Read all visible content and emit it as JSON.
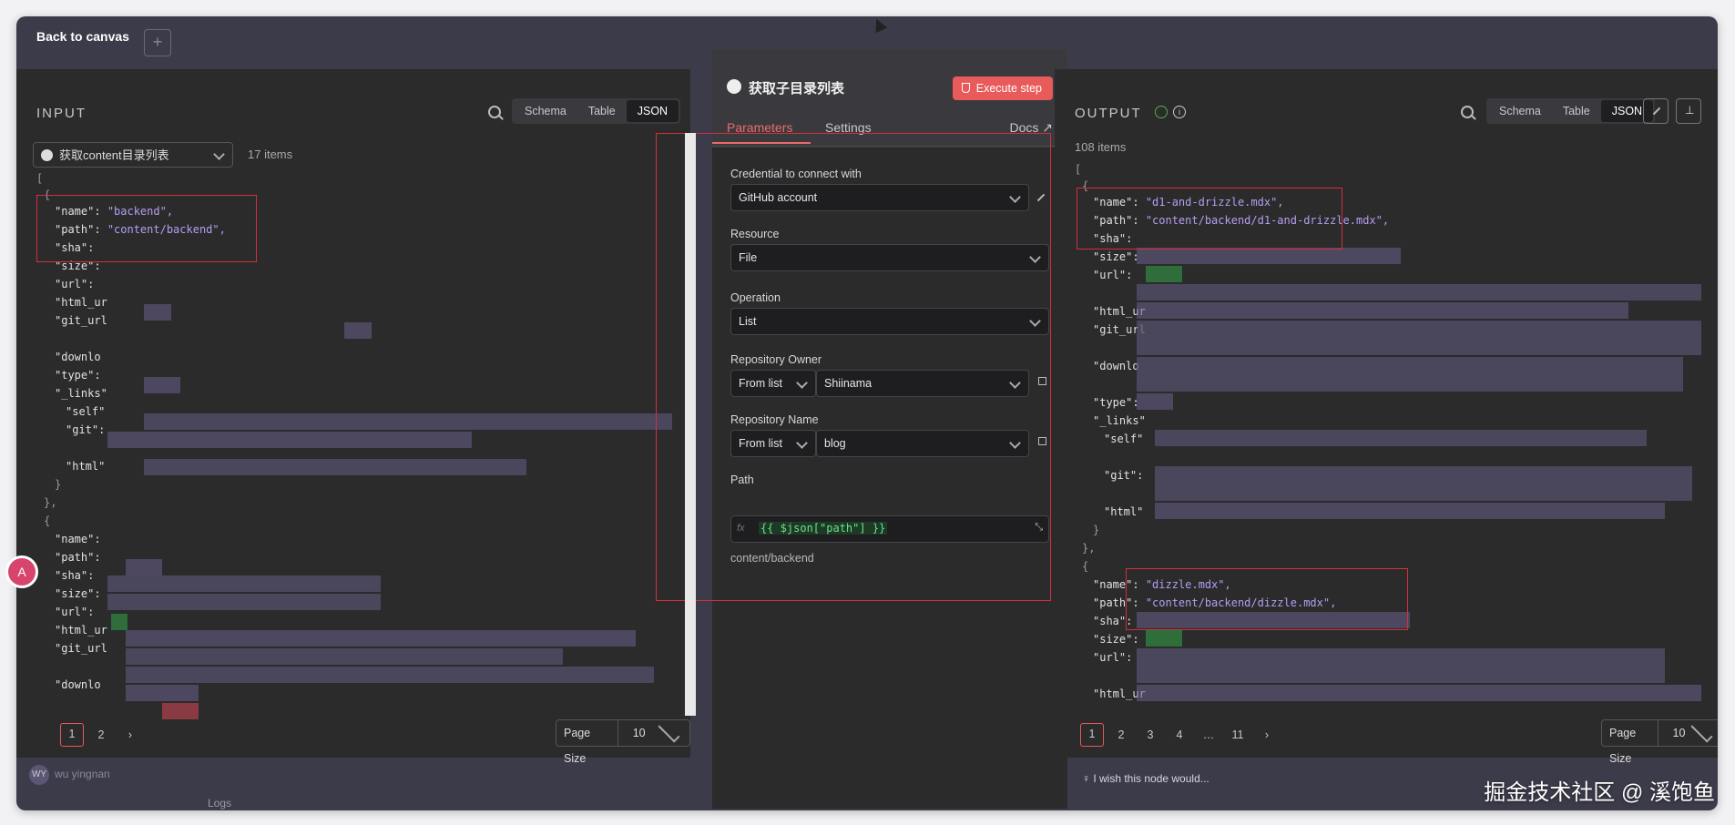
{
  "topbar": {
    "back_label": "Back to canvas",
    "plus_label": "+"
  },
  "input": {
    "title": "INPUT",
    "views": [
      "Schema",
      "Table",
      "JSON"
    ],
    "active_view": "JSON",
    "source_node": "获取content目录列表",
    "items_count": "17 items",
    "record1": {
      "name_key": "\"name\":",
      "name_val": "\"backend\",",
      "path_key": "\"path\":",
      "path_val": "\"content/backend\","
    },
    "keys": [
      "\"sha\":",
      "\"size\":",
      "\"url\":",
      "\"html_ur",
      "\"git_url",
      "\"downlo",
      "\"type\":",
      "\"_links\"",
      "\"self\"",
      "\"git\":",
      "\"html\"",
      "\"name\":",
      "\"path\":",
      "\"sha\":",
      "\"size\":",
      "\"url\":",
      "\"html_ur",
      "\"git_url",
      "\"downlo"
    ],
    "pages": [
      "1",
      "2"
    ],
    "page_size_label": "Page Size",
    "page_size": "10"
  },
  "node": {
    "title": "获取子目录列表",
    "execute_label": "Execute step",
    "tab_parameters": "Parameters",
    "tab_settings": "Settings",
    "docs_label": "Docs",
    "credential_label": "Credential to connect with",
    "credential_value": "GitHub account",
    "resource_label": "Resource",
    "resource_value": "File",
    "operation_label": "Operation",
    "operation_value": "List",
    "owner_label": "Repository Owner",
    "owner_mode": "From list",
    "owner_value": "Shiinama",
    "repo_label": "Repository Name",
    "repo_mode": "From list",
    "repo_value": "blog",
    "path_label": "Path",
    "path_fx": "fx",
    "path_expression": "{{ $json[\"path\"] }}",
    "path_result": "content/backend"
  },
  "output": {
    "title": "OUTPUT",
    "views": [
      "Schema",
      "Table",
      "JSON"
    ],
    "active_view": "JSON",
    "items_count": "108 items",
    "record1": {
      "name_key": "\"name\":",
      "name_val": "\"d1-and-drizzle.mdx\",",
      "path_key": "\"path\":",
      "path_val": "\"content/backend/d1-and-drizzle.mdx\","
    },
    "record2": {
      "name_key": "\"name\":",
      "name_val": "\"dizzle.mdx\",",
      "path_key": "\"path\":",
      "path_val": "\"content/backend/dizzle.mdx\","
    },
    "keys": [
      "\"sha\":",
      "\"size\":",
      "\"url\":",
      "\"html_ur",
      "\"git_url",
      "\"downlo",
      "\"type\":",
      "\"_links\"",
      "\"self\"",
      "\"git\":",
      "\"html\"",
      "\"sha\":",
      "\"size\":",
      "\"url\":",
      "\"html_ur"
    ],
    "pages": [
      "1",
      "2",
      "3",
      "4",
      "…",
      "11"
    ],
    "page_size_label": "Page Size",
    "page_size": "10"
  },
  "footer": {
    "wish": "I wish this node would...",
    "logs": "Logs",
    "user": "wu yingnan",
    "user_initials": "WY",
    "watermark": "掘金技术社区 @ 溪饱鱼"
  },
  "colors": {
    "accent": "#ec6a6a",
    "string": "#b49ef1",
    "expression": "#6ee087",
    "annotation": "#d42f3b"
  }
}
